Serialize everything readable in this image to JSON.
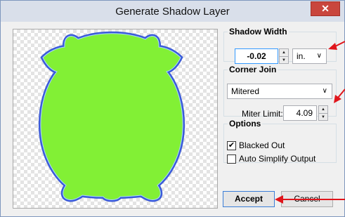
{
  "window": {
    "title": "Generate Shadow Layer",
    "close_label": "✕"
  },
  "shadow_width": {
    "legend": "Shadow Width",
    "value": "-0.02",
    "unit": "in."
  },
  "corner_join": {
    "legend": "Corner Join",
    "selected": "Mitered",
    "miter_label": "Miter Limit:",
    "miter_value": "4.09"
  },
  "options": {
    "legend": "Options",
    "blacked_out": "Blacked Out",
    "blacked_out_checked": true,
    "auto_simplify": "Auto Simplify Output",
    "auto_simplify_checked": false
  },
  "buttons": {
    "accept": "Accept",
    "cancel": "Cancel"
  },
  "colors": {
    "shape_fill": "#82f035",
    "shape_outline": "#3b5bd8",
    "arrow": "#e0151b"
  }
}
